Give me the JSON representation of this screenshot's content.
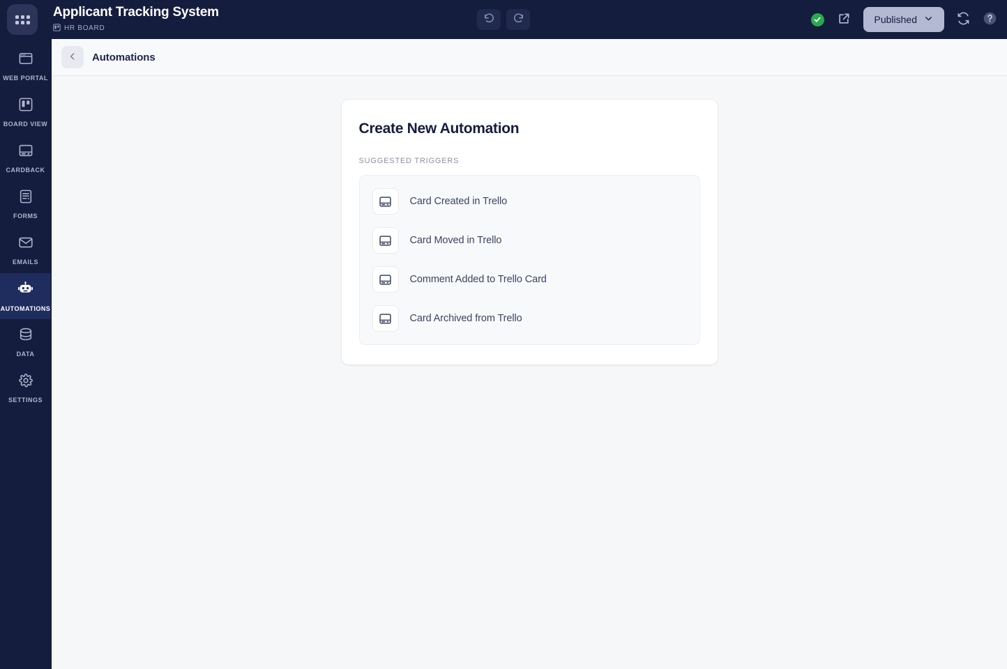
{
  "topbar": {
    "apps_icon": "apps-grid-icon",
    "app_title": "Applicant Tracking System",
    "board_badge_icon": "trello-board-icon",
    "board_name": "HR BOARD",
    "undo_icon": "undo-icon",
    "redo_icon": "redo-icon",
    "status_icon": "check-circle-icon",
    "open_external_icon": "external-link-icon",
    "publish_label": "Published",
    "publish_chevron_icon": "chevron-down-icon",
    "refresh_icon": "refresh-icon",
    "help_icon": "help-circle-icon",
    "accent_published_bg": "#b3b9d3",
    "status_green": "#2aa84f",
    "bar_bg": "#141d3d"
  },
  "sidebar": {
    "active_index": 5,
    "items": [
      {
        "label": "WEB PORTAL",
        "icon": "browser-window-icon"
      },
      {
        "label": "BOARD VIEW",
        "icon": "trello-board-icon"
      },
      {
        "label": "CARDBACK",
        "icon": "card-back-icon"
      },
      {
        "label": "FORMS",
        "icon": "form-document-icon"
      },
      {
        "label": "EMAILS",
        "icon": "envelope-icon"
      },
      {
        "label": "AUTOMATIONS",
        "icon": "robot-icon"
      },
      {
        "label": "DATA",
        "icon": "database-icon"
      },
      {
        "label": "SETTINGS",
        "icon": "gear-icon"
      }
    ]
  },
  "breadcrumb": {
    "back_icon": "chevron-left-icon",
    "title": "Automations"
  },
  "panel": {
    "title": "Create New Automation",
    "section_label": "SUGGESTED TRIGGERS",
    "triggers": [
      {
        "label": "Card Created in Trello",
        "icon": "card-back-icon"
      },
      {
        "label": "Card Moved in Trello",
        "icon": "card-back-icon"
      },
      {
        "label": "Comment Added to Trello Card",
        "icon": "card-back-icon"
      },
      {
        "label": "Card Archived from Trello",
        "icon": "card-back-icon"
      }
    ]
  }
}
